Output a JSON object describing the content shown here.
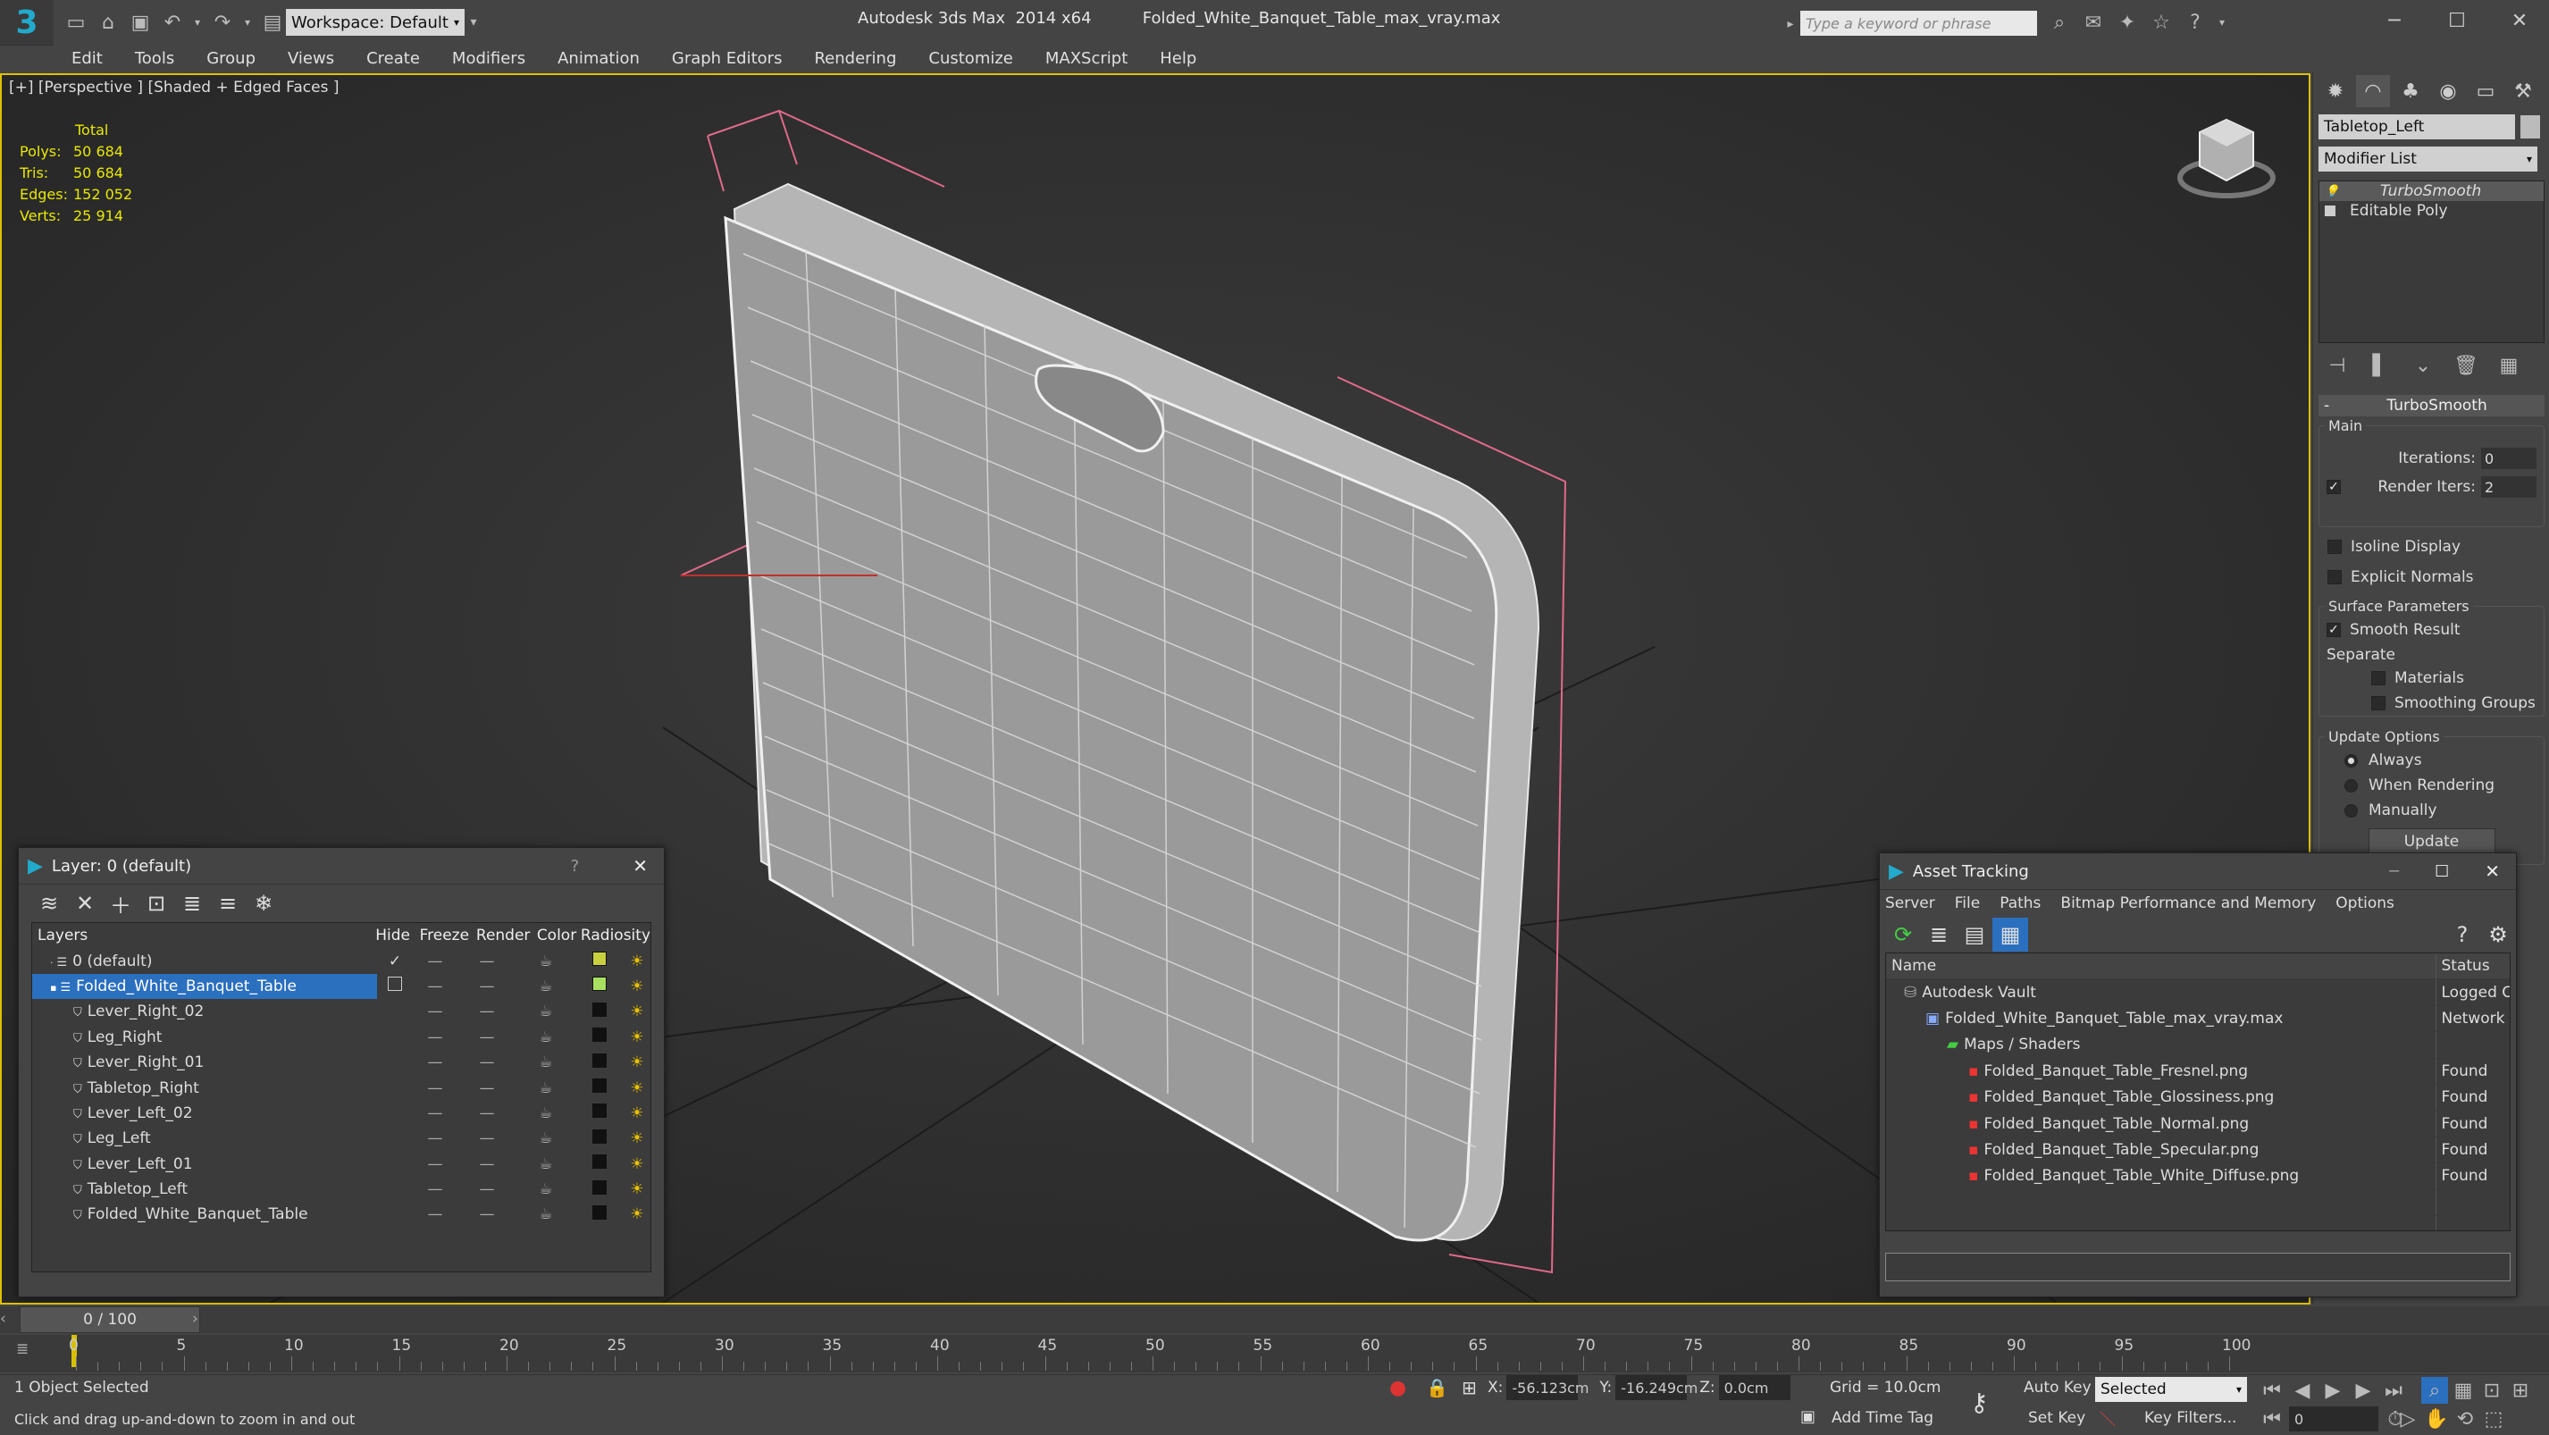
{
  "app": {
    "title": "Autodesk 3ds Max  2014 x64",
    "file": "Folded_White_Banquet_Table_max_vray.max",
    "workspace": "Workspace: Default",
    "search_placeholder": "Type a keyword or phrase"
  },
  "menu": [
    "Edit",
    "Tools",
    "Group",
    "Views",
    "Create",
    "Modifiers",
    "Animation",
    "Graph Editors",
    "Rendering",
    "Customize",
    "MAXScript",
    "Help"
  ],
  "viewport": {
    "label": "[+] [Perspective ] [Shaded + Edged Faces ]",
    "stats": {
      "header": "Total",
      "rows": [
        {
          "label": "Polys:",
          "value": "50 684"
        },
        {
          "label": "Tris:",
          "value": "50 684"
        },
        {
          "label": "Edges:",
          "value": "152 052"
        },
        {
          "label": "Verts:",
          "value": "25 914"
        }
      ]
    }
  },
  "command_panel": {
    "object_name": "Tabletop_Left",
    "modifier_list": "Modifier List",
    "stack": [
      "TurboSmooth",
      "Editable Poly"
    ],
    "rollout": "TurboSmooth",
    "main_label": "Main",
    "iterations_label": "Iterations:",
    "iterations": "0",
    "render_iters_label": "Render Iters:",
    "render_iters": "2",
    "isoline": "Isoline Display",
    "explicit_normals": "Explicit Normals",
    "surface_params": "Surface Parameters",
    "smooth_result": "Smooth Result",
    "separate": "Separate",
    "materials": "Materials",
    "smoothing_groups": "Smoothing Groups",
    "update_options": "Update Options",
    "always": "Always",
    "when_rendering": "When Rendering",
    "manually": "Manually",
    "update_button": "Update"
  },
  "layer_window": {
    "title": "Layer: 0 (default)",
    "help": "?",
    "columns": [
      "Layers",
      "Hide",
      "Freeze",
      "Render",
      "Color",
      "Radiosity"
    ],
    "rows": [
      {
        "name": "0 (default)",
        "level": 1,
        "color": "#c8d040"
      },
      {
        "name": "Folded_White_Banquet_Table",
        "level": 1,
        "color": "#a8e060",
        "selected": true
      },
      {
        "name": "Lever_Right_02",
        "level": 2,
        "color": "#111111"
      },
      {
        "name": "Leg_Right",
        "level": 2,
        "color": "#111111"
      },
      {
        "name": "Lever_Right_01",
        "level": 2,
        "color": "#111111"
      },
      {
        "name": "Tabletop_Right",
        "level": 2,
        "color": "#111111"
      },
      {
        "name": "Lever_Left_02",
        "level": 2,
        "color": "#111111"
      },
      {
        "name": "Leg_Left",
        "level": 2,
        "color": "#111111"
      },
      {
        "name": "Lever_Left_01",
        "level": 2,
        "color": "#111111"
      },
      {
        "name": "Tabletop_Left",
        "level": 2,
        "color": "#111111"
      },
      {
        "name": "Folded_White_Banquet_Table",
        "level": 2,
        "color": "#111111"
      }
    ]
  },
  "asset_window": {
    "title": "Asset Tracking",
    "menu": [
      "Server",
      "File",
      "Paths",
      "Bitmap Performance and Memory",
      "Options"
    ],
    "columns": [
      "Name",
      "Status"
    ],
    "rows": [
      {
        "name": "Autodesk Vault",
        "status": "Logged C",
        "level": 1
      },
      {
        "name": "Folded_White_Banquet_Table_max_vray.max",
        "status": "Network I",
        "level": 2
      },
      {
        "name": "Maps / Shaders",
        "status": "",
        "level": 3
      },
      {
        "name": "Folded_Banquet_Table_Fresnel.png",
        "status": "Found",
        "level": 4
      },
      {
        "name": "Folded_Banquet_Table_Glossiness.png",
        "status": "Found",
        "level": 4
      },
      {
        "name": "Folded_Banquet_Table_Normal.png",
        "status": "Found",
        "level": 4
      },
      {
        "name": "Folded_Banquet_Table_Specular.png",
        "status": "Found",
        "level": 4
      },
      {
        "name": "Folded_Banquet_Table_White_Diffuse.png",
        "status": "Found",
        "level": 4
      }
    ]
  },
  "timeline": {
    "frame": "0 / 100",
    "ticks": [
      "0",
      "5",
      "10",
      "15",
      "20",
      "25",
      "30",
      "35",
      "40",
      "45",
      "50",
      "55",
      "60",
      "65",
      "70",
      "75",
      "80",
      "85",
      "90",
      "95",
      "100"
    ]
  },
  "status": {
    "selection": "1 Object Selected",
    "prompt": "Click and drag up-and-down to zoom in and out",
    "x_label": "X:",
    "x": "-56.123cm",
    "y_label": "Y:",
    "y": "-16.249cm",
    "z_label": "Z:",
    "z": "0.0cm",
    "grid": "Grid = 10.0cm",
    "auto_key": "Auto Key",
    "set_key": "Set Key",
    "selected": "Selected",
    "key_filters": "Key Filters...",
    "add_time_tag": "Add Time Tag",
    "frame_field": "0"
  }
}
